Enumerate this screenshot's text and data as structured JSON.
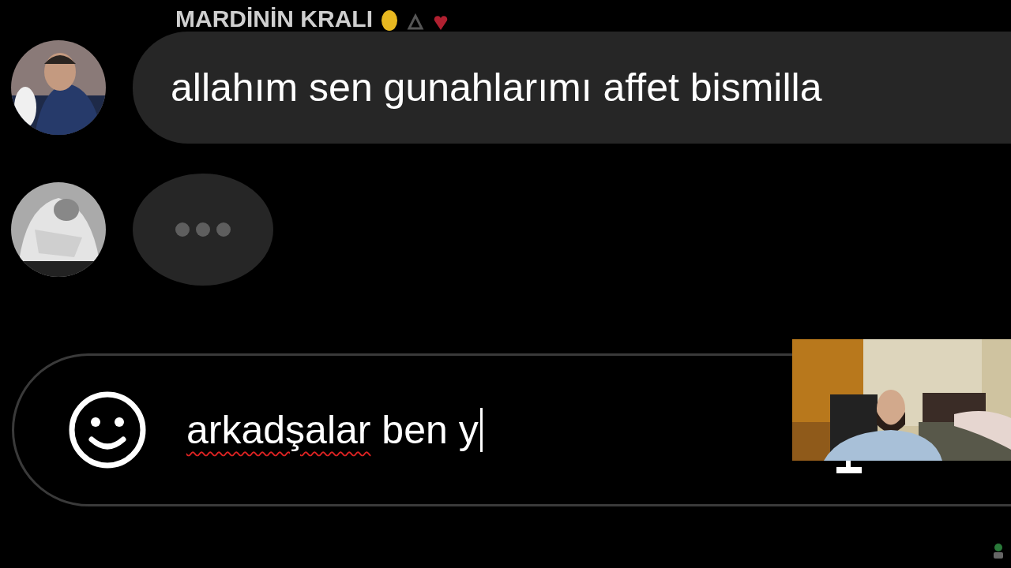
{
  "sender_name": "MARDİNİN KRALI",
  "messages": [
    {
      "kind": "text",
      "text": "allahım sen gunahlarımı affet bismilla"
    },
    {
      "kind": "typing"
    }
  ],
  "composer": {
    "value": "arkadşalar ben y",
    "first_word_misspelled": true,
    "focused": true
  }
}
